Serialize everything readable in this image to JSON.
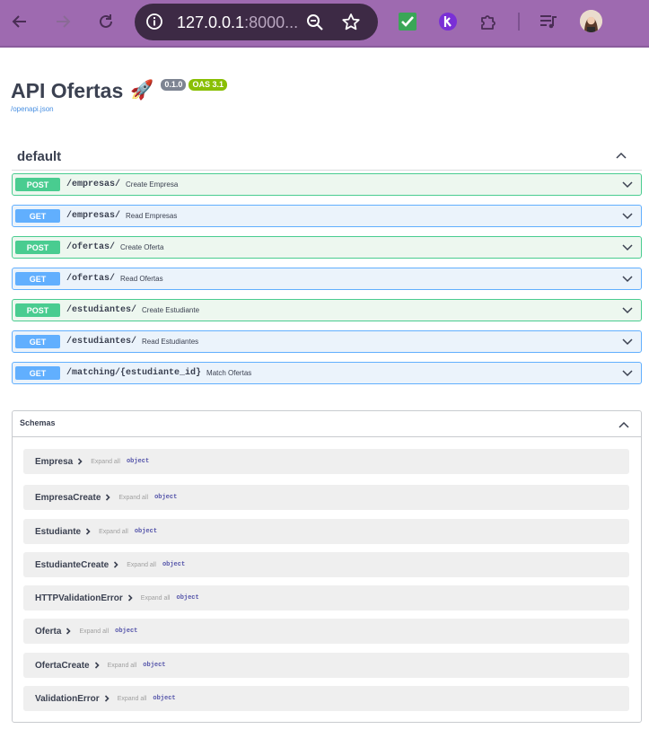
{
  "browser": {
    "url_host": "127.0.0.1",
    "url_rest": ":8000...",
    "colors": {
      "frame": "#9e6ab0",
      "omnibox": "#3d2a45"
    }
  },
  "header": {
    "title": "API Ofertas",
    "title_emoji": "🚀",
    "version_badge": "0.1.0",
    "oas_badge": "OAS 3.1",
    "spec_link": "/openapi.json"
  },
  "section": {
    "title": "default"
  },
  "operations": [
    {
      "method": "POST",
      "path": "/empresas/",
      "summary": "Create Empresa"
    },
    {
      "method": "GET",
      "path": "/empresas/",
      "summary": "Read Empresas"
    },
    {
      "method": "POST",
      "path": "/ofertas/",
      "summary": "Create Oferta"
    },
    {
      "method": "GET",
      "path": "/ofertas/",
      "summary": "Read Ofertas"
    },
    {
      "method": "POST",
      "path": "/estudiantes/",
      "summary": "Create Estudiante"
    },
    {
      "method": "GET",
      "path": "/estudiantes/",
      "summary": "Read Estudiantes"
    },
    {
      "method": "GET",
      "path": "/matching/{estudiante_id}",
      "summary": "Match Ofertas"
    }
  ],
  "schemas": {
    "title": "Schemas",
    "expand_label": "Expand all",
    "type_label": "object",
    "items": [
      "Empresa",
      "EmpresaCreate",
      "Estudiante",
      "EstudianteCreate",
      "HTTPValidationError",
      "Oferta",
      "OfertaCreate",
      "ValidationError"
    ]
  },
  "colors": {
    "post": "#49cc90",
    "get": "#61affe",
    "badge_oas": "#89bf04"
  }
}
